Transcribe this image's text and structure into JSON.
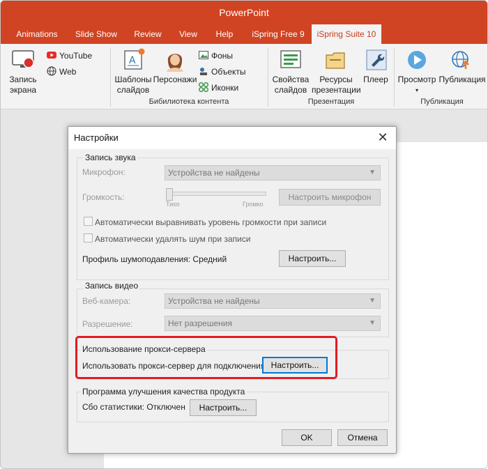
{
  "app": {
    "title": "PowerPoint"
  },
  "tabs": [
    "Animations",
    "Slide Show",
    "Review",
    "View",
    "Help",
    "iSpring Free 9",
    "iSpring Suite 10"
  ],
  "ribbon": {
    "record_screen": [
      "Запись",
      "экрана"
    ],
    "youtube": "YouTube",
    "web": "Web",
    "templates": [
      "Шаблоны",
      "слайдов"
    ],
    "characters": "Персонажи",
    "backgrounds": "Фоны",
    "objects": "Объекты",
    "icons": "Иконки",
    "library_group": "Бибилиотека контента",
    "slide_props": [
      "Свойства",
      "слайдов"
    ],
    "resources": [
      "Ресурсы",
      "презентации"
    ],
    "player": "Плеер",
    "presentation_group": "Презентация",
    "preview": "Просмотр",
    "publish": "Публикация",
    "publish_group": "Публикация"
  },
  "dialog": {
    "title": "Настройки",
    "audio": {
      "title": "Запись звука",
      "mic_label": "Микрофон:",
      "mic_value": "Устройства не найдены",
      "volume_label": "Громкость:",
      "slider_min": "Тихо",
      "slider_max": "Громко",
      "setup_mic": "Настроить микрофон",
      "auto_level": "Автоматически выравнивать уровень громкости при записи",
      "auto_noise": "Автоматически удалять шум при записи",
      "noise_profile": "Профиль шумоподавления: Средний",
      "setup": "Настроить..."
    },
    "video": {
      "title": "Запись видео",
      "webcam_label": "Веб-камера:",
      "webcam_value": "Устройства не найдены",
      "resolution_label": "Разрешение:",
      "resolution_value": "Нет разрешения"
    },
    "proxy": {
      "title": "Использование прокси-сервера",
      "text": "Использовать прокси-сервер для подключения",
      "setup": "Настроить..."
    },
    "quality": {
      "title": "Программа улучшения качества продукта",
      "text": "Сбо статистики: Отключен",
      "setup": "Настроить..."
    },
    "ok": "OK",
    "cancel": "Отмена"
  },
  "colors": {
    "accent": "#d04423",
    "highlight": "#e11b22",
    "focus": "#0078d7"
  }
}
